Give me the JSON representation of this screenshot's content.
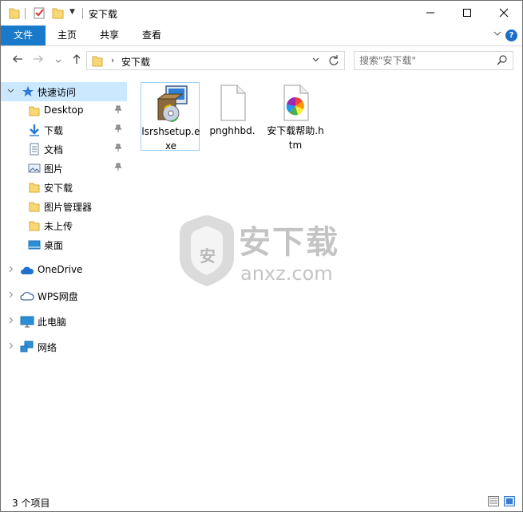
{
  "window": {
    "title": "安下载",
    "minimize_icon": "minimize-icon",
    "maximize_icon": "maximize-icon",
    "close_icon": "close-icon"
  },
  "ribbon": {
    "tabs": [
      {
        "label": "文件"
      },
      {
        "label": "主页"
      },
      {
        "label": "共享"
      },
      {
        "label": "查看"
      }
    ]
  },
  "navbar": {
    "breadcrumb": "安下载",
    "search_placeholder": "搜索\"安下载\""
  },
  "sidebar": {
    "items": [
      {
        "label": "快速访问",
        "icon": "star-icon"
      },
      {
        "label": "Desktop",
        "icon": "folder-icon",
        "pinned": true
      },
      {
        "label": "下载",
        "icon": "download-icon",
        "pinned": true
      },
      {
        "label": "文档",
        "icon": "document-icon",
        "pinned": true
      },
      {
        "label": "图片",
        "icon": "pictures-icon",
        "pinned": true
      },
      {
        "label": "安下载",
        "icon": "folder-icon"
      },
      {
        "label": "图片管理器",
        "icon": "folder-icon"
      },
      {
        "label": "未上传",
        "icon": "folder-icon"
      },
      {
        "label": "桌面",
        "icon": "desktop-icon"
      },
      {
        "label": "OneDrive",
        "icon": "cloud-icon"
      },
      {
        "label": "WPS网盘",
        "icon": "cloud-outline-icon"
      },
      {
        "label": "此电脑",
        "icon": "computer-icon"
      },
      {
        "label": "网络",
        "icon": "network-icon"
      }
    ]
  },
  "files": [
    {
      "name": "lsrshsetup.exe",
      "icon": "installer-icon"
    },
    {
      "name": "pnghhbd.",
      "icon": "blank-file-icon"
    },
    {
      "name": "安下载帮助.htm",
      "icon": "htm-file-icon"
    }
  ],
  "watermark": {
    "text_cn": "安下载",
    "text_en": "anxz.com",
    "shield_char": "安"
  },
  "status": {
    "item_count": "3 个项目"
  },
  "colors": {
    "accent": "#1979ca",
    "selected_bg": "#cce8ff",
    "folder": "#f8d775"
  }
}
